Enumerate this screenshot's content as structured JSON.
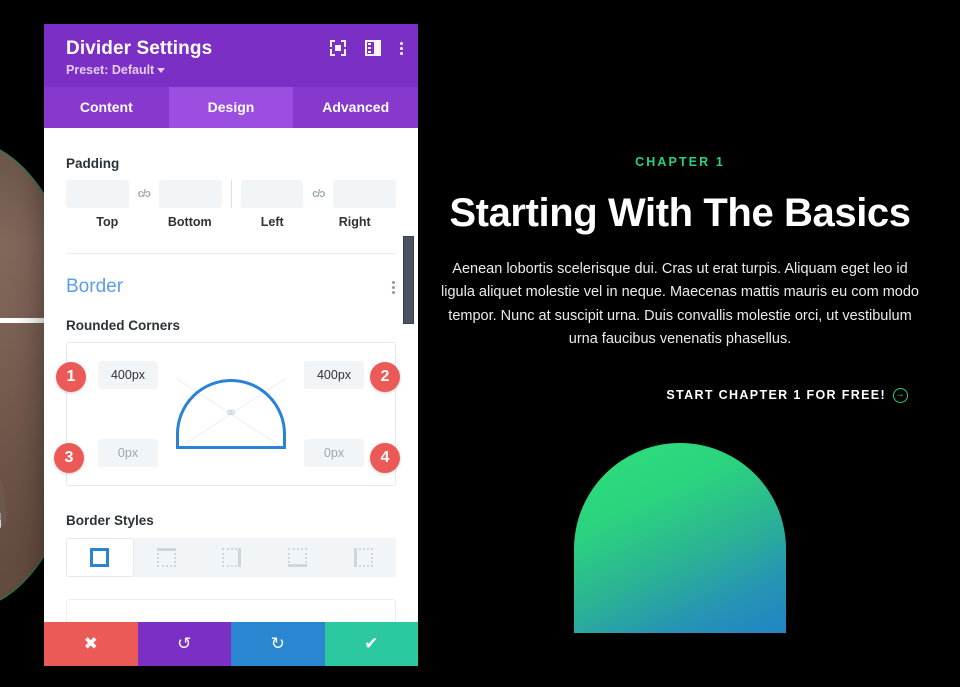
{
  "modal": {
    "title": "Divider Settings",
    "preset_label": "Preset: Default",
    "header_icons": [
      {
        "name": "focus-icon",
        "glyph": ""
      },
      {
        "name": "layout-columns-icon",
        "glyph": ""
      },
      {
        "name": "more-options-icon",
        "glyph": ""
      }
    ],
    "tabs": [
      {
        "label": "Content",
        "active": false
      },
      {
        "label": "Design",
        "active": true
      },
      {
        "label": "Advanced",
        "active": false
      }
    ],
    "padding": {
      "label": "Padding",
      "link_glyph": "c/ɔ",
      "fields": [
        {
          "label": "Top",
          "value": ""
        },
        {
          "label": "Bottom",
          "value": ""
        },
        {
          "label": "Left",
          "value": ""
        },
        {
          "label": "Right",
          "value": ""
        }
      ]
    },
    "border": {
      "title": "Border",
      "rounded_corners_label": "Rounded Corners",
      "corners": [
        {
          "badge": "1",
          "position": "top-left",
          "value": "400px",
          "muted": false
        },
        {
          "badge": "2",
          "position": "top-right",
          "value": "400px",
          "muted": false
        },
        {
          "badge": "3",
          "position": "bottom-left",
          "value": "0px",
          "muted": true
        },
        {
          "badge": "4",
          "position": "bottom-right",
          "value": "0px",
          "muted": true
        }
      ],
      "link_icon_glyph": "⚭",
      "border_styles_label": "Border Styles",
      "border_styles": [
        {
          "name": "all-borders",
          "active": true
        },
        {
          "name": "top-border",
          "active": false
        },
        {
          "name": "right-border",
          "active": false
        },
        {
          "name": "bottom-border",
          "active": false
        },
        {
          "name": "left-border",
          "active": false
        }
      ]
    },
    "footer_buttons": [
      {
        "name": "cancel-button",
        "glyph": "✖",
        "color": "#ec5a58"
      },
      {
        "name": "undo-button",
        "glyph": "↺",
        "color": "#7b2fc4"
      },
      {
        "name": "redo-button",
        "glyph": "↻",
        "color": "#2a86d1"
      },
      {
        "name": "save-button",
        "glyph": "✔",
        "color": "#2cc9a0"
      }
    ]
  },
  "hero": {
    "eyebrow": "CHAPTER 1",
    "title": "Starting With The Basics",
    "body": "Aenean lobortis scelerisque dui. Cras ut erat turpis. Aliquam eget leo id ligula aliquet molestie vel in neque. Maecenas mattis mauris eu com modo tempor. Nunc at suscipit urna. Duis convallis molestie orci, ut vestibulum urna faucibus venenatis phasellus.",
    "cta_label": "START CHAPTER 1 FOR FREE!",
    "cta_arrow_glyph": "→"
  },
  "colors": {
    "brand_purple": "#7b2fc4",
    "tab_active": "#9c4ee0",
    "accent_blue": "#2a82d6",
    "badge_red": "#ec5a58",
    "accent_green": "#24d37f",
    "gradient_start": "#2ce07a",
    "gradient_end": "#2185c5",
    "page_background": "#000000"
  }
}
